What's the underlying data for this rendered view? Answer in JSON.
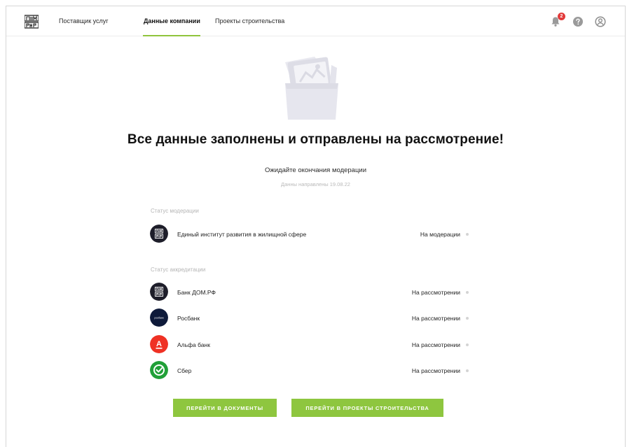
{
  "header": {
    "nav": {
      "provider": "Поставщик услуг",
      "company": "Данные компании",
      "projects": "Проекты строительства"
    },
    "notifications_count": "2"
  },
  "main": {
    "headline": "Все данные заполнены и отправлены на рассмотрение!",
    "subtitle": "Ожидайте окончания модерации",
    "sent_date": "Данны направлены 19.08.22"
  },
  "moderation": {
    "label": "Статус модерации",
    "items": [
      {
        "name": "Единый институт развития в жилищной сфере",
        "status": "На модерации",
        "logo_icon": "dom-rf-logo-icon",
        "logo_color": "#1e1e2a"
      }
    ]
  },
  "accreditation": {
    "label": "Статус аккредитации",
    "items": [
      {
        "name": "Банк ДОМ.РФ",
        "status": "На рассмотрении",
        "logo_icon": "dom-rf-logo-icon",
        "logo_color": "#1e1e2a"
      },
      {
        "name": "Росбанк",
        "status": "На рассмотрении",
        "logo_icon": "rosbank-logo-icon",
        "logo_color": "#0e1a3a",
        "logo_text": "росбанк"
      },
      {
        "name": "Альфа банк",
        "status": "На рассмотрении",
        "logo_icon": "alfa-bank-logo-icon",
        "logo_color": "#ef3124",
        "logo_text": "А"
      },
      {
        "name": "Сбер",
        "status": "На рассмотрении",
        "logo_icon": "sber-logo-icon",
        "logo_color": "#21a038"
      }
    ]
  },
  "actions": {
    "go_documents": "ПЕРЕЙТИ В ДОКУМЕНТЫ",
    "go_projects": "ПЕРЕЙТИ В ПРОЕКТЫ СТРОИТЕЛЬСТВА"
  },
  "colors": {
    "accent": "#8ec63f",
    "badge": "#e23a3a"
  }
}
